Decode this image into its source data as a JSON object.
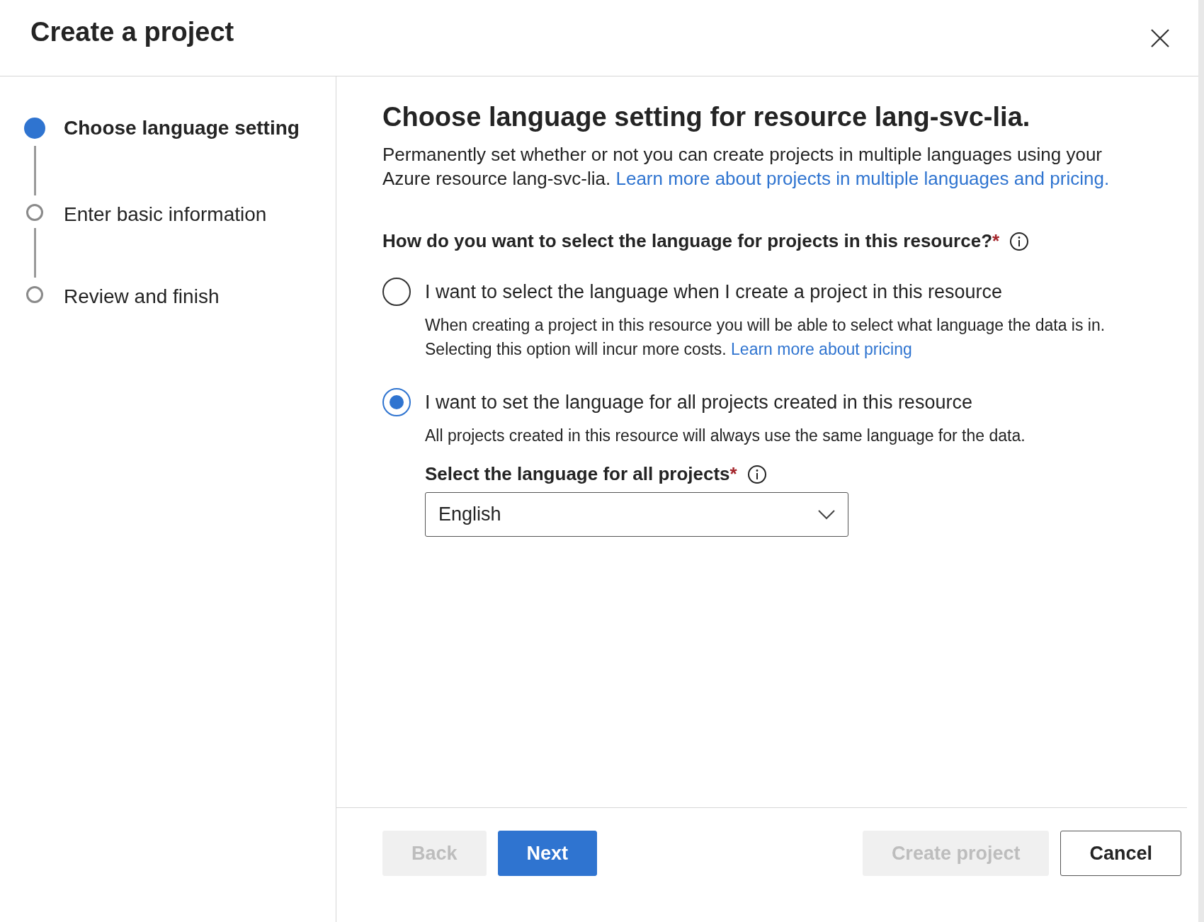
{
  "dialog": {
    "title": "Create a project"
  },
  "steps": [
    {
      "label": "Choose language setting",
      "selected": true
    },
    {
      "label": "Enter basic information",
      "selected": false
    },
    {
      "label": "Review and finish",
      "selected": false
    }
  ],
  "content": {
    "heading": "Choose language setting for resource lang-svc-lia.",
    "description": "Permanently set whether or not you can create projects in multiple languages using your Azure resource lang-svc-lia.",
    "description_link": "Learn more about projects in multiple languages and pricing.",
    "question": {
      "label": "How do you want to select the language for projects in this resource?",
      "required_mark": "*"
    },
    "options": [
      {
        "label": "I want to select the language when I create a project in this resource",
        "help": "When creating a project in this resource you will be able to select what language the data is in. Selecting this option will incur more costs.",
        "help_link": "Learn more about pricing",
        "selected": false
      },
      {
        "label": "I want to set the language for all projects created in this resource",
        "help": "All projects created in this resource will always use the same language for the data.",
        "selected": true,
        "language_select": {
          "label": "Select the language for all projects",
          "required_mark": "*",
          "value": "English"
        }
      }
    ]
  },
  "footer": {
    "buttons": [
      {
        "label": "Back",
        "kind": "secondary",
        "disabled": true
      },
      {
        "label": "Next",
        "kind": "primary",
        "disabled": false
      },
      {
        "label": "Create project",
        "kind": "primary",
        "disabled": true
      },
      {
        "label": "Cancel",
        "kind": "secondary",
        "disabled": false
      }
    ]
  }
}
